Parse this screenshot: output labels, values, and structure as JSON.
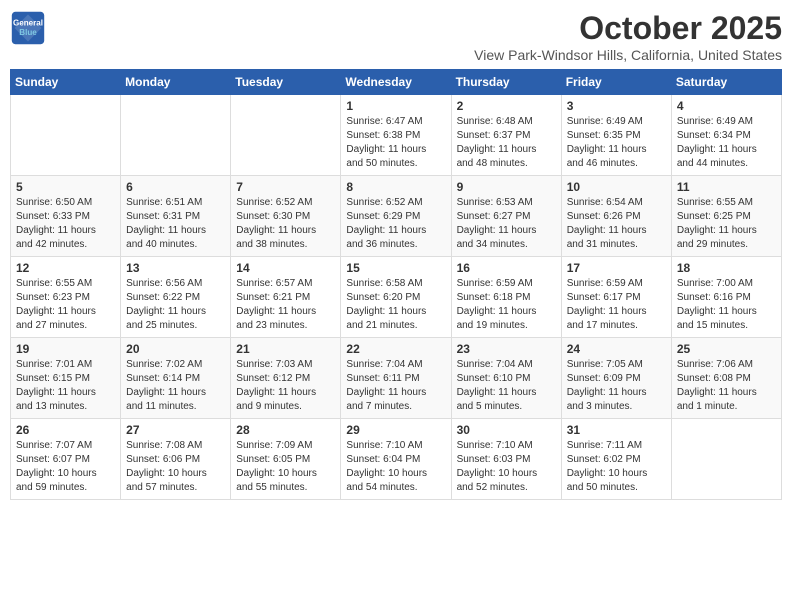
{
  "header": {
    "logo_line1": "General",
    "logo_line2": "Blue",
    "month": "October 2025",
    "location": "View Park-Windsor Hills, California, United States"
  },
  "weekdays": [
    "Sunday",
    "Monday",
    "Tuesday",
    "Wednesday",
    "Thursday",
    "Friday",
    "Saturday"
  ],
  "weeks": [
    [
      {
        "day": "",
        "info": ""
      },
      {
        "day": "",
        "info": ""
      },
      {
        "day": "",
        "info": ""
      },
      {
        "day": "1",
        "info": "Sunrise: 6:47 AM\nSunset: 6:38 PM\nDaylight: 11 hours\nand 50 minutes."
      },
      {
        "day": "2",
        "info": "Sunrise: 6:48 AM\nSunset: 6:37 PM\nDaylight: 11 hours\nand 48 minutes."
      },
      {
        "day": "3",
        "info": "Sunrise: 6:49 AM\nSunset: 6:35 PM\nDaylight: 11 hours\nand 46 minutes."
      },
      {
        "day": "4",
        "info": "Sunrise: 6:49 AM\nSunset: 6:34 PM\nDaylight: 11 hours\nand 44 minutes."
      }
    ],
    [
      {
        "day": "5",
        "info": "Sunrise: 6:50 AM\nSunset: 6:33 PM\nDaylight: 11 hours\nand 42 minutes."
      },
      {
        "day": "6",
        "info": "Sunrise: 6:51 AM\nSunset: 6:31 PM\nDaylight: 11 hours\nand 40 minutes."
      },
      {
        "day": "7",
        "info": "Sunrise: 6:52 AM\nSunset: 6:30 PM\nDaylight: 11 hours\nand 38 minutes."
      },
      {
        "day": "8",
        "info": "Sunrise: 6:52 AM\nSunset: 6:29 PM\nDaylight: 11 hours\nand 36 minutes."
      },
      {
        "day": "9",
        "info": "Sunrise: 6:53 AM\nSunset: 6:27 PM\nDaylight: 11 hours\nand 34 minutes."
      },
      {
        "day": "10",
        "info": "Sunrise: 6:54 AM\nSunset: 6:26 PM\nDaylight: 11 hours\nand 31 minutes."
      },
      {
        "day": "11",
        "info": "Sunrise: 6:55 AM\nSunset: 6:25 PM\nDaylight: 11 hours\nand 29 minutes."
      }
    ],
    [
      {
        "day": "12",
        "info": "Sunrise: 6:55 AM\nSunset: 6:23 PM\nDaylight: 11 hours\nand 27 minutes."
      },
      {
        "day": "13",
        "info": "Sunrise: 6:56 AM\nSunset: 6:22 PM\nDaylight: 11 hours\nand 25 minutes."
      },
      {
        "day": "14",
        "info": "Sunrise: 6:57 AM\nSunset: 6:21 PM\nDaylight: 11 hours\nand 23 minutes."
      },
      {
        "day": "15",
        "info": "Sunrise: 6:58 AM\nSunset: 6:20 PM\nDaylight: 11 hours\nand 21 minutes."
      },
      {
        "day": "16",
        "info": "Sunrise: 6:59 AM\nSunset: 6:18 PM\nDaylight: 11 hours\nand 19 minutes."
      },
      {
        "day": "17",
        "info": "Sunrise: 6:59 AM\nSunset: 6:17 PM\nDaylight: 11 hours\nand 17 minutes."
      },
      {
        "day": "18",
        "info": "Sunrise: 7:00 AM\nSunset: 6:16 PM\nDaylight: 11 hours\nand 15 minutes."
      }
    ],
    [
      {
        "day": "19",
        "info": "Sunrise: 7:01 AM\nSunset: 6:15 PM\nDaylight: 11 hours\nand 13 minutes."
      },
      {
        "day": "20",
        "info": "Sunrise: 7:02 AM\nSunset: 6:14 PM\nDaylight: 11 hours\nand 11 minutes."
      },
      {
        "day": "21",
        "info": "Sunrise: 7:03 AM\nSunset: 6:12 PM\nDaylight: 11 hours\nand 9 minutes."
      },
      {
        "day": "22",
        "info": "Sunrise: 7:04 AM\nSunset: 6:11 PM\nDaylight: 11 hours\nand 7 minutes."
      },
      {
        "day": "23",
        "info": "Sunrise: 7:04 AM\nSunset: 6:10 PM\nDaylight: 11 hours\nand 5 minutes."
      },
      {
        "day": "24",
        "info": "Sunrise: 7:05 AM\nSunset: 6:09 PM\nDaylight: 11 hours\nand 3 minutes."
      },
      {
        "day": "25",
        "info": "Sunrise: 7:06 AM\nSunset: 6:08 PM\nDaylight: 11 hours\nand 1 minute."
      }
    ],
    [
      {
        "day": "26",
        "info": "Sunrise: 7:07 AM\nSunset: 6:07 PM\nDaylight: 10 hours\nand 59 minutes."
      },
      {
        "day": "27",
        "info": "Sunrise: 7:08 AM\nSunset: 6:06 PM\nDaylight: 10 hours\nand 57 minutes."
      },
      {
        "day": "28",
        "info": "Sunrise: 7:09 AM\nSunset: 6:05 PM\nDaylight: 10 hours\nand 55 minutes."
      },
      {
        "day": "29",
        "info": "Sunrise: 7:10 AM\nSunset: 6:04 PM\nDaylight: 10 hours\nand 54 minutes."
      },
      {
        "day": "30",
        "info": "Sunrise: 7:10 AM\nSunset: 6:03 PM\nDaylight: 10 hours\nand 52 minutes."
      },
      {
        "day": "31",
        "info": "Sunrise: 7:11 AM\nSunset: 6:02 PM\nDaylight: 10 hours\nand 50 minutes."
      },
      {
        "day": "",
        "info": ""
      }
    ]
  ]
}
